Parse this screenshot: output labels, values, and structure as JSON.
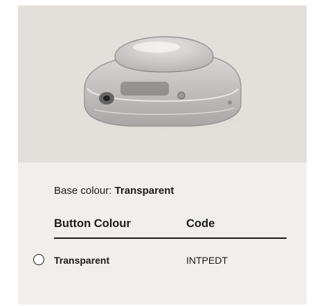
{
  "product": {
    "image_alt": "transparent inline switch product photo",
    "base_colour_label": "Base colour:",
    "base_colour_value": "Transparent"
  },
  "table": {
    "headers": [
      "Button Colour",
      "Code"
    ],
    "rows": [
      {
        "colour": "Transparent",
        "code": "INTPEDT",
        "selected": false
      }
    ]
  },
  "colors": {
    "card_background": "#f2eeeb",
    "photo_background": "#e3dfdb",
    "text": "#1a1a1a"
  }
}
